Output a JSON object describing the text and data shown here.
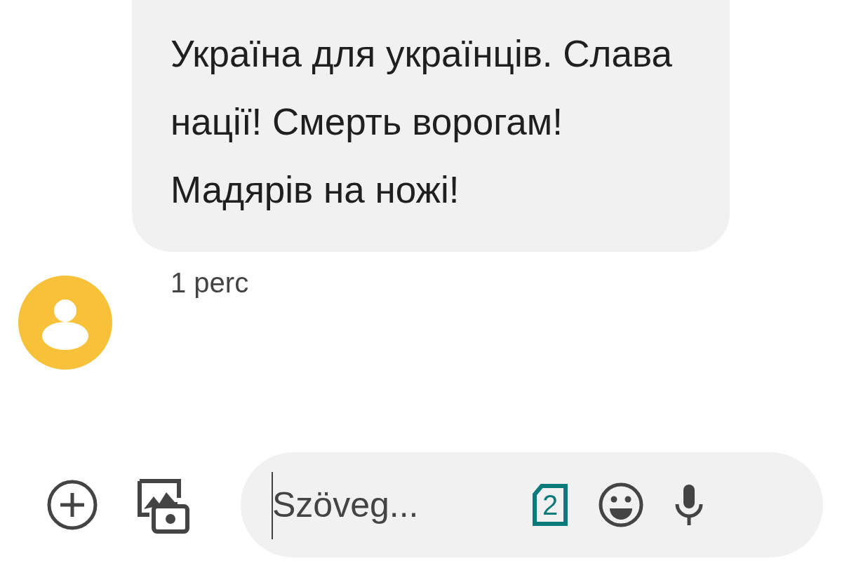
{
  "messages": [
    {
      "kind": "incoming",
      "text": "Україна для українців. Слава нації! Смерть ворогам! Мадярів на ножі!",
      "time": "1 perc"
    }
  ],
  "composer": {
    "placeholder": "Szöveg...",
    "sim_label": "2"
  }
}
